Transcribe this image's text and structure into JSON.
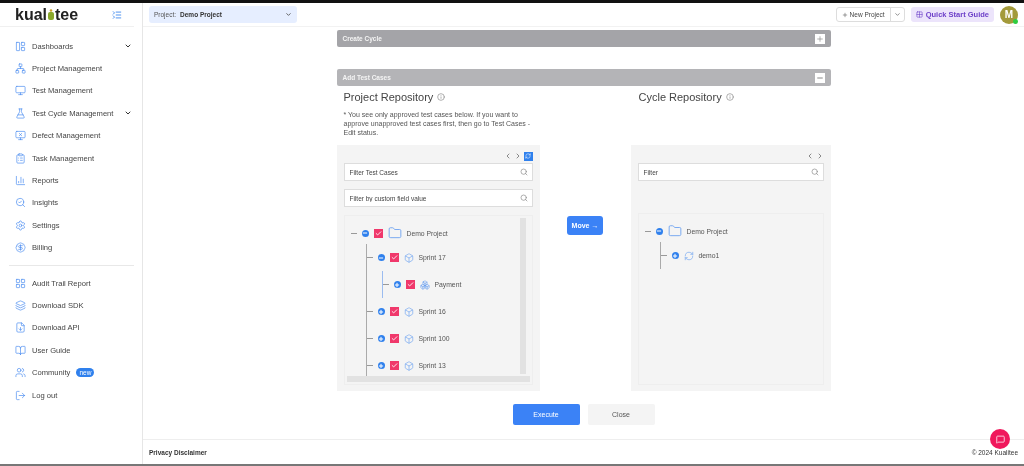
{
  "logo": {
    "left": "kual",
    "right": "tee"
  },
  "sidebar": {
    "groups": [
      [
        {
          "label": "Dashboards",
          "expandable": true
        },
        {
          "label": "Project Management",
          "expandable": false
        },
        {
          "label": "Test Management",
          "expandable": false
        },
        {
          "label": "Test Cycle Management",
          "expandable": true
        },
        {
          "label": "Defect Management",
          "expandable": false
        },
        {
          "label": "Task Management",
          "expandable": false
        },
        {
          "label": "Reports",
          "expandable": false
        },
        {
          "label": "Insights",
          "expandable": false
        },
        {
          "label": "Settings",
          "expandable": false
        },
        {
          "label": "Billing",
          "expandable": false
        }
      ],
      [
        {
          "label": "Audit Trail Report",
          "expandable": false
        },
        {
          "label": "Download SDK",
          "expandable": false
        },
        {
          "label": "Download API",
          "expandable": false
        },
        {
          "label": "User Guide",
          "expandable": false
        },
        {
          "label": "Community",
          "expandable": false,
          "badge": "new"
        },
        {
          "label": "Log out",
          "expandable": false
        }
      ]
    ]
  },
  "header": {
    "project_label": "Project:",
    "project_value": "Demo Project",
    "new_project": "New Project",
    "quick_start": "Quick Start Guide",
    "avatar": "M"
  },
  "sections": [
    {
      "title": "Create Cycle",
      "expanded": false
    },
    {
      "title": "Add Test Cases",
      "expanded": true
    }
  ],
  "project_repository": {
    "title": "Project Repository",
    "note": "* You see only approved test cases below. If you want to approve unapproved test cases first, then go to Test Cases - Edit status.",
    "filter_placeholder": "Filter Test Cases",
    "custom_filter_placeholder": "Filter by custom field value",
    "tree": [
      {
        "kind": "folder",
        "label": "Demo Project",
        "checked": true,
        "expanded": true,
        "children": [
          {
            "kind": "sprint",
            "label": "Sprint 17",
            "checked": true,
            "expanded": true,
            "children": [
              {
                "kind": "module",
                "label": "Payment",
                "checked": true,
                "expanded": false
              }
            ]
          },
          {
            "kind": "sprint",
            "label": "Sprint 16",
            "checked": true,
            "expanded": false
          },
          {
            "kind": "sprint",
            "label": "Sprint 100",
            "checked": true,
            "expanded": false
          },
          {
            "kind": "sprint",
            "label": "Sprint 13",
            "checked": true,
            "expanded": false
          }
        ]
      }
    ]
  },
  "move_button": "Move →",
  "cycle_repository": {
    "title": "Cycle Repository",
    "filter_placeholder": "Filter",
    "tree": [
      {
        "kind": "folder",
        "label": "Demo Project",
        "expanded": true,
        "children": [
          {
            "kind": "cycle",
            "label": "demo1",
            "expanded": false
          }
        ]
      }
    ]
  },
  "buttons": [
    "Execute",
    "Close"
  ],
  "footer": {
    "left": "Privacy Disclaimer",
    "right": "© 2024 Kualitee"
  }
}
